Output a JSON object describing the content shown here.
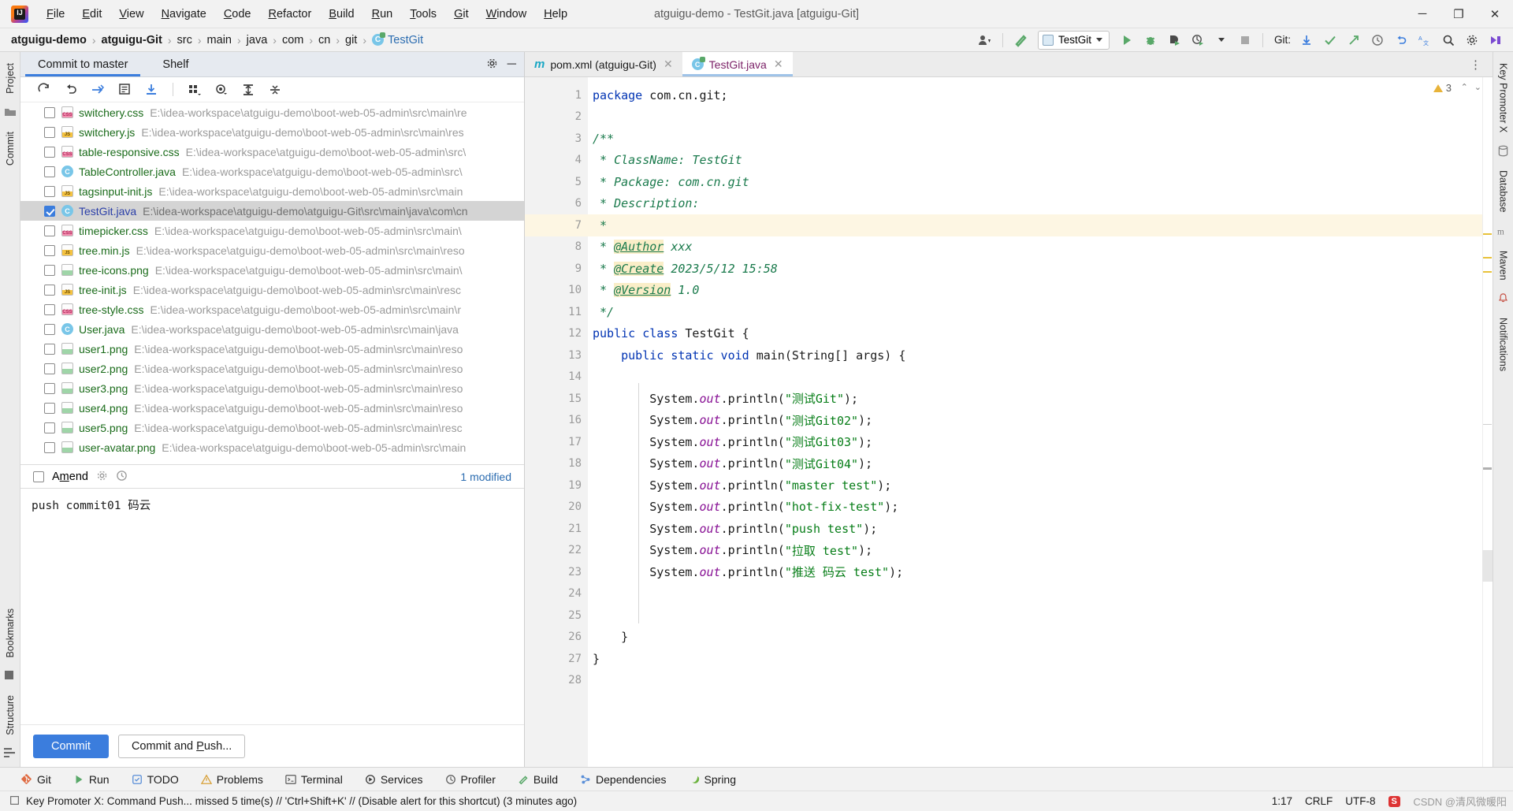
{
  "window": {
    "title": "atguigu-demo - TestGit.java [atguigu-Git]",
    "minimize": "─",
    "maximize": "❐",
    "close": "✕"
  },
  "menubar": [
    {
      "label": "File"
    },
    {
      "label": "Edit"
    },
    {
      "label": "View"
    },
    {
      "label": "Navigate"
    },
    {
      "label": "Code"
    },
    {
      "label": "Refactor"
    },
    {
      "label": "Build"
    },
    {
      "label": "Run"
    },
    {
      "label": "Tools"
    },
    {
      "label": "Git"
    },
    {
      "label": "Window"
    },
    {
      "label": "Help"
    }
  ],
  "breadcrumb": [
    {
      "label": "atguigu-demo",
      "bold": true
    },
    {
      "label": "atguigu-Git",
      "bold": true
    },
    {
      "label": "src"
    },
    {
      "label": "main"
    },
    {
      "label": "java"
    },
    {
      "label": "com"
    },
    {
      "label": "cn"
    },
    {
      "label": "git"
    },
    {
      "label": "TestGit",
      "file": true
    }
  ],
  "toolbar": {
    "run_config": "TestGit",
    "git_label": "Git:",
    "icons": [
      "user-avatar-icon",
      "build-hammer-icon",
      "run-icon",
      "debug-icon",
      "run-coverage-icon",
      "profiler-icon",
      "stop-icon",
      "git-update-icon",
      "git-commit-icon",
      "git-push-icon",
      "history-icon",
      "undo-icon",
      "translate-icon",
      "search-icon",
      "settings-icon"
    ]
  },
  "left_strip": {
    "top": [
      "Project"
    ],
    "bottom": [
      "Commit",
      "Bookmarks",
      "Structure"
    ]
  },
  "right_strip": {
    "items": [
      "Key Promoter X",
      "Database",
      "Maven",
      "Notifications"
    ]
  },
  "commit_panel": {
    "tabs": [
      {
        "label": "Commit to master",
        "active": true
      },
      {
        "label": "Shelf",
        "active": false
      }
    ],
    "tab_icons": [
      "settings-gear-icon",
      "minimize-icon"
    ],
    "toolbar_icons": [
      "refresh-icon",
      "rollback-icon",
      "diff-icon",
      "show-diff-icon",
      "update-icon",
      "group-by-icon",
      "preview-eye-icon",
      "expand-all-icon",
      "collapse-all-icon"
    ],
    "files": [
      {
        "name": "switchery.css",
        "path": "E:\\idea-workspace\\atguigu-demo\\boot-web-05-admin\\src\\main\\re",
        "type": "css",
        "checked": false,
        "selected": false
      },
      {
        "name": "switchery.js",
        "path": "E:\\idea-workspace\\atguigu-demo\\boot-web-05-admin\\src\\main\\res",
        "type": "js",
        "checked": false,
        "selected": false
      },
      {
        "name": "table-responsive.css",
        "path": "E:\\idea-workspace\\atguigu-demo\\boot-web-05-admin\\src\\",
        "type": "css",
        "checked": false,
        "selected": false
      },
      {
        "name": "TableController.java",
        "path": "E:\\idea-workspace\\atguigu-demo\\boot-web-05-admin\\src\\",
        "type": "java",
        "checked": false,
        "selected": false
      },
      {
        "name": "tagsinput-init.js",
        "path": "E:\\idea-workspace\\atguigu-demo\\boot-web-05-admin\\src\\main",
        "type": "js",
        "checked": false,
        "selected": false
      },
      {
        "name": "TestGit.java",
        "path": "E:\\idea-workspace\\atguigu-demo\\atguigu-Git\\src\\main\\java\\com\\cn",
        "type": "java",
        "checked": true,
        "selected": true
      },
      {
        "name": "timepicker.css",
        "path": "E:\\idea-workspace\\atguigu-demo\\boot-web-05-admin\\src\\main\\",
        "type": "css",
        "checked": false,
        "selected": false
      },
      {
        "name": "tree.min.js",
        "path": "E:\\idea-workspace\\atguigu-demo\\boot-web-05-admin\\src\\main\\reso",
        "type": "minjs",
        "checked": false,
        "selected": false
      },
      {
        "name": "tree-icons.png",
        "path": "E:\\idea-workspace\\atguigu-demo\\boot-web-05-admin\\src\\main\\",
        "type": "png",
        "checked": false,
        "selected": false
      },
      {
        "name": "tree-init.js",
        "path": "E:\\idea-workspace\\atguigu-demo\\boot-web-05-admin\\src\\main\\resc",
        "type": "js",
        "checked": false,
        "selected": false
      },
      {
        "name": "tree-style.css",
        "path": "E:\\idea-workspace\\atguigu-demo\\boot-web-05-admin\\src\\main\\r",
        "type": "css",
        "checked": false,
        "selected": false
      },
      {
        "name": "User.java",
        "path": "E:\\idea-workspace\\atguigu-demo\\boot-web-05-admin\\src\\main\\java",
        "type": "java",
        "checked": false,
        "selected": false
      },
      {
        "name": "user1.png",
        "path": "E:\\idea-workspace\\atguigu-demo\\boot-web-05-admin\\src\\main\\reso",
        "type": "png",
        "checked": false,
        "selected": false
      },
      {
        "name": "user2.png",
        "path": "E:\\idea-workspace\\atguigu-demo\\boot-web-05-admin\\src\\main\\reso",
        "type": "png",
        "checked": false,
        "selected": false
      },
      {
        "name": "user3.png",
        "path": "E:\\idea-workspace\\atguigu-demo\\boot-web-05-admin\\src\\main\\reso",
        "type": "png",
        "checked": false,
        "selected": false
      },
      {
        "name": "user4.png",
        "path": "E:\\idea-workspace\\atguigu-demo\\boot-web-05-admin\\src\\main\\reso",
        "type": "png",
        "checked": false,
        "selected": false
      },
      {
        "name": "user5.png",
        "path": "E:\\idea-workspace\\atguigu-demo\\boot-web-05-admin\\src\\main\\resc",
        "type": "png",
        "checked": false,
        "selected": false
      },
      {
        "name": "user-avatar.png",
        "path": "E:\\idea-workspace\\atguigu-demo\\boot-web-05-admin\\src\\main",
        "type": "png",
        "checked": false,
        "selected": false
      }
    ],
    "amend_label": "Amend",
    "amend_checked": false,
    "modified_label": "1 modified",
    "commit_message": "push commit01 码云",
    "commit_button": "Commit",
    "commit_push_button": "Commit and Push..."
  },
  "editor": {
    "tabs": [
      {
        "label": "pom.xml (atguigu-Git)",
        "icon": "maven-icon",
        "active": false
      },
      {
        "label": "TestGit.java",
        "icon": "java-class-icon",
        "active": true
      }
    ],
    "warning_count": "3",
    "lines": [
      {
        "n": 1,
        "tokens": [
          {
            "t": "package ",
            "c": "kw"
          },
          {
            "t": "com.cn.git;",
            "c": "plain"
          }
        ]
      },
      {
        "n": 2,
        "tokens": []
      },
      {
        "n": 3,
        "fold": "top",
        "tokens": [
          {
            "t": "/**",
            "c": "cmt"
          }
        ]
      },
      {
        "n": 4,
        "tokens": [
          {
            "t": " * ClassName: TestGit",
            "c": "cmt"
          }
        ]
      },
      {
        "n": 5,
        "tokens": [
          {
            "t": " * Package: com.cn.git",
            "c": "cmt"
          }
        ]
      },
      {
        "n": 6,
        "tokens": [
          {
            "t": " * Description:",
            "c": "cmt"
          }
        ]
      },
      {
        "n": 7,
        "hl": true,
        "tokens": [
          {
            "t": " *",
            "c": "cmt"
          }
        ]
      },
      {
        "n": 8,
        "tokens": [
          {
            "t": " * ",
            "c": "cmt"
          },
          {
            "t": "@Author",
            "c": "tag"
          },
          {
            "t": " xxx",
            "c": "cmt"
          }
        ]
      },
      {
        "n": 9,
        "tokens": [
          {
            "t": " * ",
            "c": "cmt"
          },
          {
            "t": "@Create",
            "c": "tag"
          },
          {
            "t": " 2023/5/12 15:58",
            "c": "cmt"
          }
        ]
      },
      {
        "n": 10,
        "tokens": [
          {
            "t": " * ",
            "c": "cmt"
          },
          {
            "t": "@Version",
            "c": "tag"
          },
          {
            "t": " 1.0",
            "c": "cmt"
          }
        ]
      },
      {
        "n": 11,
        "fold": "bottom",
        "tokens": [
          {
            "t": " */",
            "c": "cmt"
          }
        ]
      },
      {
        "n": 12,
        "run": true,
        "tokens": [
          {
            "t": "public class ",
            "c": "kw"
          },
          {
            "t": "TestGit ",
            "c": "cls"
          },
          {
            "t": "{",
            "c": "plain"
          }
        ]
      },
      {
        "n": 13,
        "run": true,
        "fold": "top",
        "tokens": [
          {
            "t": "    public static void ",
            "c": "kw"
          },
          {
            "t": "main(",
            "c": "plain"
          },
          {
            "t": "String",
            "c": "cls"
          },
          {
            "t": "[] args) {",
            "c": "plain"
          }
        ]
      },
      {
        "n": 14,
        "tokens": []
      },
      {
        "n": 15,
        "tokens": [
          {
            "t": "        System.",
            "c": "plain"
          },
          {
            "t": "out",
            "c": "field"
          },
          {
            "t": ".println(",
            "c": "plain"
          },
          {
            "t": "\"测试Git\"",
            "c": "str"
          },
          {
            "t": ");",
            "c": "plain"
          }
        ]
      },
      {
        "n": 16,
        "tokens": [
          {
            "t": "        System.",
            "c": "plain"
          },
          {
            "t": "out",
            "c": "field"
          },
          {
            "t": ".println(",
            "c": "plain"
          },
          {
            "t": "\"测试Git02\"",
            "c": "str"
          },
          {
            "t": ");",
            "c": "plain"
          }
        ]
      },
      {
        "n": 17,
        "tokens": [
          {
            "t": "        System.",
            "c": "plain"
          },
          {
            "t": "out",
            "c": "field"
          },
          {
            "t": ".println(",
            "c": "plain"
          },
          {
            "t": "\"测试Git03\"",
            "c": "str"
          },
          {
            "t": ");",
            "c": "plain"
          }
        ]
      },
      {
        "n": 18,
        "tokens": [
          {
            "t": "        System.",
            "c": "plain"
          },
          {
            "t": "out",
            "c": "field"
          },
          {
            "t": ".println(",
            "c": "plain"
          },
          {
            "t": "\"测试Git04\"",
            "c": "str"
          },
          {
            "t": ");",
            "c": "plain"
          }
        ]
      },
      {
        "n": 19,
        "tokens": [
          {
            "t": "        System.",
            "c": "plain"
          },
          {
            "t": "out",
            "c": "field"
          },
          {
            "t": ".println(",
            "c": "plain"
          },
          {
            "t": "\"master test\"",
            "c": "str"
          },
          {
            "t": ");",
            "c": "plain"
          }
        ]
      },
      {
        "n": 20,
        "tokens": [
          {
            "t": "        System.",
            "c": "plain"
          },
          {
            "t": "out",
            "c": "field"
          },
          {
            "t": ".println(",
            "c": "plain"
          },
          {
            "t": "\"hot-fix-test\"",
            "c": "str"
          },
          {
            "t": ");",
            "c": "plain"
          }
        ]
      },
      {
        "n": 21,
        "tokens": [
          {
            "t": "        System.",
            "c": "plain"
          },
          {
            "t": "out",
            "c": "field"
          },
          {
            "t": ".println(",
            "c": "plain"
          },
          {
            "t": "\"push test\"",
            "c": "str"
          },
          {
            "t": ");",
            "c": "plain"
          }
        ]
      },
      {
        "n": 22,
        "tokens": [
          {
            "t": "        System.",
            "c": "plain"
          },
          {
            "t": "out",
            "c": "field"
          },
          {
            "t": ".println(",
            "c": "plain"
          },
          {
            "t": "\"拉取 test\"",
            "c": "str"
          },
          {
            "t": ");",
            "c": "plain"
          }
        ]
      },
      {
        "n": 23,
        "tokens": [
          {
            "t": "        System.",
            "c": "plain"
          },
          {
            "t": "out",
            "c": "field"
          },
          {
            "t": ".println(",
            "c": "plain"
          },
          {
            "t": "\"推送 码云 test\"",
            "c": "str"
          },
          {
            "t": ");",
            "c": "plain"
          }
        ]
      },
      {
        "n": 24,
        "tokens": []
      },
      {
        "n": 25,
        "tokens": []
      },
      {
        "n": 26,
        "fold": "bottom",
        "tokens": [
          {
            "t": "    }",
            "c": "plain"
          }
        ]
      },
      {
        "n": 27,
        "tokens": [
          {
            "t": "}",
            "c": "plain"
          }
        ]
      },
      {
        "n": 28,
        "tokens": []
      }
    ]
  },
  "bottom_bar": [
    {
      "label": "Git",
      "icon": "git-icon"
    },
    {
      "label": "Run",
      "icon": "run-icon"
    },
    {
      "label": "TODO",
      "icon": "todo-icon"
    },
    {
      "label": "Problems",
      "icon": "problems-icon"
    },
    {
      "label": "Terminal",
      "icon": "terminal-icon"
    },
    {
      "label": "Services",
      "icon": "services-icon"
    },
    {
      "label": "Profiler",
      "icon": "profiler-icon"
    },
    {
      "label": "Build",
      "icon": "build-icon"
    },
    {
      "label": "Dependencies",
      "icon": "dependencies-icon"
    },
    {
      "label": "Spring",
      "icon": "spring-icon"
    }
  ],
  "status_bar": {
    "message": "Key Promoter X: Command Push... missed 5 time(s) // 'Ctrl+Shift+K' // (Disable alert for this shortcut) (3 minutes ago)",
    "caret": "1:17",
    "line_separator": "CRLF",
    "encoding": "UTF-8",
    "watermark": "CSDN @清风微暖阳",
    "csdn": "S"
  }
}
